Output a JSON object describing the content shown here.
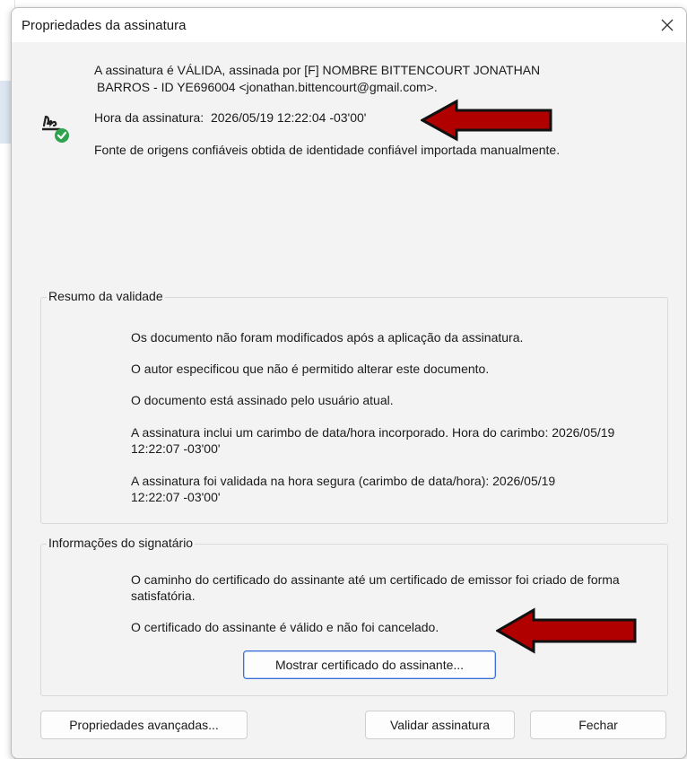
{
  "dialog": {
    "title": "Propriedades da assinatura",
    "close_icon": "close-icon"
  },
  "signature": {
    "icon": "signature-valid-icon",
    "line1": "A assinatura é VÁLIDA, assinada por [F] NOMBRE BITTENCOURT JONATHAN",
    "line2": "BARROS - ID YE696004 <jonathan.bittencourt@gmail.com>.",
    "time_label": "Hora da assinatura:",
    "time_value": "2026/05/19 12:22:04 -03'00'",
    "source": "Fonte de origens confiáveis obtida de identidade confiável importada manualmente."
  },
  "validity": {
    "title": "Resumo da validade",
    "items": [
      "Os documento não foram modificados após a aplicação da assinatura.",
      "O autor especificou que não é permitido alterar este documento.",
      "O documento está assinado pelo usuário atual.",
      "A assinatura inclui um carimbo de data/hora incorporado. Hora do carimbo: 2026/05/19 12:22:07 -03'00'",
      "A assinatura foi validada na hora segura (carimbo de data/hora): 2026/05/19 12:22:07 -03'00'"
    ]
  },
  "signer": {
    "title": "Informações do signatário",
    "items": [
      "O caminho do certificado do assinante até um certificado de emissor foi criado de forma satisfatória.",
      "O certificado do assinante é válido e não foi cancelado."
    ],
    "show_cert_button": "Mostrar certificado do assinante..."
  },
  "buttons": {
    "advanced": "Propriedades avançadas...",
    "validate": "Validar assinatura",
    "close": "Fechar"
  },
  "colors": {
    "arrow": "#b00000",
    "arrow_outline": "#111111",
    "check": "#2ea44f",
    "default_button_border": "#3a6fd8"
  }
}
